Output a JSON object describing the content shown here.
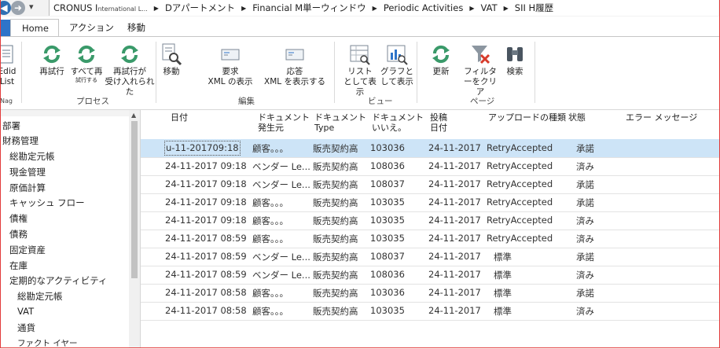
{
  "address_bar": {
    "crumbs": [
      {
        "label": "CRONUS I",
        "sub": "nternational L..."
      },
      {
        "label": "Dアパートメント"
      },
      {
        "label": "Financial M単ーウィンドウ"
      },
      {
        "label": "Periodic Activities"
      },
      {
        "label": "VAT"
      },
      {
        "label": "SII H履歴"
      }
    ]
  },
  "ribbon": {
    "tabs": [
      "Home",
      "アクション",
      "移動"
    ],
    "active_tab": "Home",
    "partial_left": {
      "label1": "Edid",
      "label2": "List",
      "group": "Nag"
    },
    "groups": [
      {
        "name": "プロセス",
        "buttons": [
          {
            "label": "再試行",
            "icon": "refresh-icon"
          },
          {
            "label": "すべて再",
            "sub": "試行する",
            "icon": "refresh-icon"
          },
          {
            "label": "再試行が",
            "sub": "受け入れられた",
            "icon": "refresh-icon"
          }
        ]
      },
      {
        "name": "編集",
        "buttons": [
          {
            "label": "移動",
            "icon": "document-search-icon"
          },
          {
            "label": "要求",
            "sub": "XML の表示",
            "icon": "envelope-icon"
          },
          {
            "label": "応答",
            "sub": "XML を表示する",
            "icon": "envelope-icon"
          }
        ]
      },
      {
        "name": "ビュー",
        "buttons": [
          {
            "label": "リスト",
            "sub": "として表示",
            "icon": "list-view-icon"
          },
          {
            "label": "グラフと",
            "sub": "して表示",
            "icon": "chart-view-icon"
          }
        ]
      },
      {
        "name": "ページ",
        "buttons": [
          {
            "label": "更新",
            "icon": "refresh-icon"
          },
          {
            "label": "フィルタ",
            "sub": "ーをクリア",
            "icon": "clear-filter-icon"
          },
          {
            "label": "検索",
            "icon": "binoculars-icon"
          }
        ]
      }
    ]
  },
  "nav": {
    "items": [
      {
        "label": "部署",
        "indent": 0
      },
      {
        "label": "財務管理",
        "indent": 0
      },
      {
        "label": "総勘定元帳",
        "indent": 1
      },
      {
        "label": "現金管理",
        "indent": 1
      },
      {
        "label": "原価計算",
        "indent": 1
      },
      {
        "label": "キャッシュ フロー",
        "indent": 1
      },
      {
        "label": "債権",
        "indent": 1
      },
      {
        "label": "債務",
        "indent": 1
      },
      {
        "label": "固定資産",
        "indent": 1
      },
      {
        "label": "在庫",
        "indent": 1
      },
      {
        "label": "定期的なアクティビティ",
        "indent": 1
      },
      {
        "label": "総勘定元帳",
        "indent": 2
      },
      {
        "label": "VAT",
        "indent": 2
      },
      {
        "label": "通貨",
        "indent": 2
      },
      {
        "label": "ファクト イヤー",
        "indent": 2
      }
    ]
  },
  "grid": {
    "columns": [
      {
        "l1": "日付",
        "l2": ""
      },
      {
        "l1": "ドキュメント",
        "l2": "発生元"
      },
      {
        "l1": "ドキュメント",
        "l2": "Type"
      },
      {
        "l1": "ドキュメント",
        "l2": "いいえ。"
      },
      {
        "l1": "投稿",
        "l2": "日付"
      },
      {
        "l1": "アップロードの種類",
        "l2": ""
      },
      {
        "l1": "状態",
        "l2": ""
      },
      {
        "l1": "エラー メッセージ",
        "l2": ""
      }
    ],
    "rows": [
      [
        "u-11-201709:18",
        "顧客。。。",
        "販売契約高",
        "103036",
        "24-11-2017",
        "RetryAccepted",
        "承諾",
        ""
      ],
      [
        "24-11-2017 09:18",
        "ベンダー Le...",
        "販売契約高",
        "108036",
        "24-11-2017",
        "RetryAccepted",
        "済み",
        ""
      ],
      [
        "24-11-2017 09:18",
        "ベンダー Le...",
        "販売契約高",
        "108037",
        "24-11-2017",
        "RetryAccepted",
        "承諾",
        ""
      ],
      [
        "24-11-2017 09:18",
        "顧客。。。",
        "販売契約高",
        "103035",
        "24-11-2017",
        "RetryAccepted",
        "承諾",
        ""
      ],
      [
        "24-11-2017 09:18",
        "顧客。。。",
        "販売契約高",
        "103035",
        "24-11-2017",
        "RetryAccepted",
        "済み",
        ""
      ],
      [
        "24-11-2017 08:59",
        "顧客。。。",
        "販売契約高",
        "103035",
        "24-11-2017",
        "RetryAccepted",
        "済み",
        ""
      ],
      [
        "24-11-2017 08:59",
        "ベンダー Le...",
        "販売契約高",
        "108037",
        "24-11-2017",
        "標準",
        "承諾",
        ""
      ],
      [
        "24-11-2017 08:59",
        "ベンダー Le...",
        "販売契約高",
        "108036",
        "24-11-2017",
        "標準",
        "済み",
        ""
      ],
      [
        "24-11-2017 08:58",
        "顧客。。。",
        "販売契約高",
        "103036",
        "24-11-2017",
        "標準",
        "承諾",
        ""
      ],
      [
        "24-11-2017 08:58",
        "顧客。。。",
        "販売契約高",
        "103035",
        "24-11-2017",
        "標準",
        "済み",
        ""
      ]
    ],
    "selected_row": 0
  },
  "colors": {
    "accent": "#2e74c9",
    "selection": "#cde4f7",
    "frame": "#e23b3b",
    "refresh": "#3a9a6a"
  }
}
